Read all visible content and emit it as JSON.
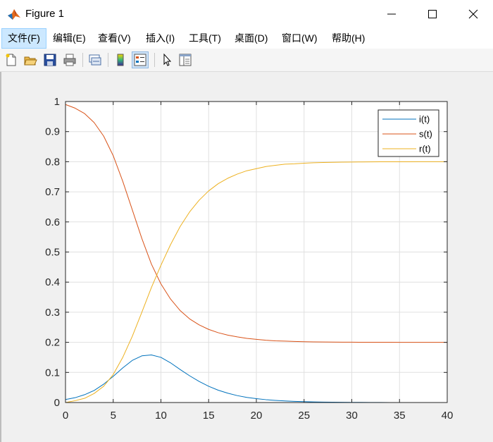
{
  "window": {
    "title": "Figure 1"
  },
  "menu": {
    "items": [
      {
        "label": "文件(F)"
      },
      {
        "label": "编辑(E)"
      },
      {
        "label": "查看(V)"
      },
      {
        "label": "插入(I)"
      },
      {
        "label": "工具(T)"
      },
      {
        "label": "桌面(D)"
      },
      {
        "label": "窗口(W)"
      },
      {
        "label": "帮助(H)"
      }
    ]
  },
  "toolbar": {
    "icons": [
      "new-figure-icon",
      "open-file-icon",
      "save-icon",
      "print-icon",
      "link-plot-icon",
      "insert-colorbar-icon",
      "insert-legend-icon",
      "edit-plot-cursor-icon",
      "property-inspector-icon"
    ]
  },
  "colors": {
    "i": "#0072bd",
    "s": "#d95319",
    "r": "#edb120",
    "axes_bg": "#ffffff",
    "grid": "#e0e0e0"
  },
  "chart_data": {
    "type": "line",
    "title": "",
    "xlabel": "",
    "ylabel": "",
    "xlim": [
      0,
      40
    ],
    "ylim": [
      0,
      1
    ],
    "xticks": [
      "0",
      "5",
      "10",
      "15",
      "20",
      "25",
      "30",
      "35",
      "40"
    ],
    "yticks": [
      "0",
      "0.1",
      "0.2",
      "0.3",
      "0.4",
      "0.5",
      "0.6",
      "0.7",
      "0.8",
      "0.9",
      "1"
    ],
    "grid": true,
    "legend_position": "top-right",
    "x": [
      0,
      1,
      2,
      3,
      4,
      5,
      6,
      7,
      8,
      9,
      10,
      11,
      12,
      13,
      14,
      15,
      16,
      17,
      18,
      19,
      20,
      21,
      22,
      23,
      24,
      25,
      26,
      27,
      28,
      29,
      30,
      31,
      32,
      33,
      34,
      35,
      36,
      37,
      38,
      39,
      40
    ],
    "series": [
      {
        "name": "i(t)",
        "values": [
          0.01,
          0.016,
          0.026,
          0.04,
          0.061,
          0.087,
          0.115,
          0.14,
          0.155,
          0.158,
          0.15,
          0.132,
          0.11,
          0.089,
          0.07,
          0.054,
          0.041,
          0.031,
          0.023,
          0.017,
          0.013,
          0.0095,
          0.007,
          0.0052,
          0.0038,
          0.0028,
          0.0021,
          0.0015,
          0.0011,
          0.0008,
          0.0006,
          0.00045,
          0.0003,
          0.0002,
          0.00015,
          0.0001,
          8e-05,
          6e-05,
          4e-05,
          3e-05,
          2e-05
        ]
      },
      {
        "name": "s(t)",
        "values": [
          0.99,
          0.978,
          0.96,
          0.93,
          0.885,
          0.82,
          0.735,
          0.64,
          0.545,
          0.46,
          0.394,
          0.344,
          0.306,
          0.278,
          0.258,
          0.243,
          0.232,
          0.224,
          0.218,
          0.213,
          0.21,
          0.207,
          0.205,
          0.204,
          0.203,
          0.202,
          0.2015,
          0.201,
          0.2008,
          0.2006,
          0.2004,
          0.2003,
          0.2002,
          0.2001,
          0.2001,
          0.2,
          0.2,
          0.2,
          0.2,
          0.2,
          0.2
        ]
      },
      {
        "name": "r(t)",
        "values": [
          0.0,
          0.006,
          0.014,
          0.03,
          0.054,
          0.093,
          0.15,
          0.22,
          0.3,
          0.382,
          0.456,
          0.524,
          0.584,
          0.633,
          0.672,
          0.703,
          0.727,
          0.745,
          0.759,
          0.77,
          0.777,
          0.784,
          0.788,
          0.792,
          0.793,
          0.795,
          0.7965,
          0.7975,
          0.7981,
          0.7986,
          0.799,
          0.7992,
          0.7995,
          0.7997,
          0.7998,
          0.7999,
          0.7999,
          0.8,
          0.8,
          0.8,
          0.8
        ]
      }
    ]
  }
}
